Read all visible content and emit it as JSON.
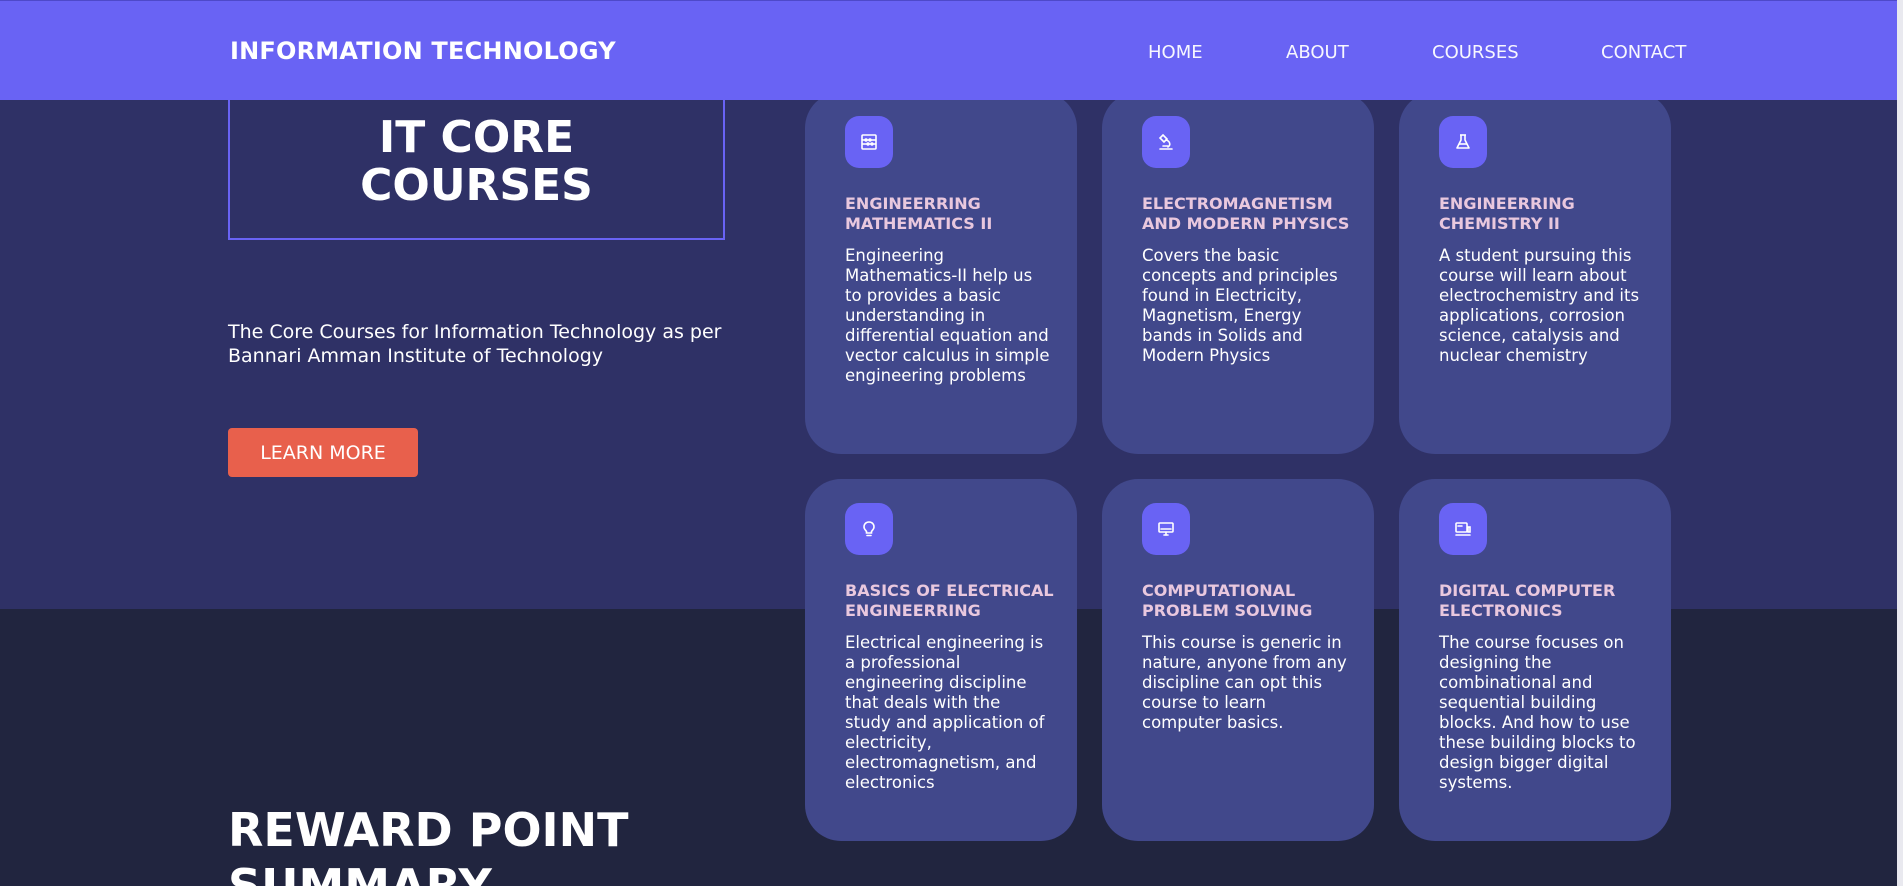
{
  "nav": {
    "brand": "INFORMATION TECHNOLOGY",
    "links": [
      "HOME",
      "ABOUT",
      "COURSES",
      "CONTACT"
    ]
  },
  "hero": {
    "title_line1": "IT CORE",
    "title_line2": "COURSES",
    "description": "The Core Courses for Information Technology as per Bannari Amman Institute of Technology",
    "button": "LEARN MORE"
  },
  "courses": [
    {
      "icon": "abacus-icon",
      "title": "ENGINEERRING MATHEMATICS II",
      "description": "Engineering Mathematics-II help us to provides a basic understanding in differential equation and vector calculus in simple engineering problems"
    },
    {
      "icon": "microscope-icon",
      "title": "ELECTROMAGNETISM AND MODERN PHYSICS",
      "description": "Covers the basic concepts and principles found in Electricity, Magnetism, Energy bands in Solids and Modern Physics"
    },
    {
      "icon": "flask-icon",
      "title": "ENGINEERRING CHEMISTRY II",
      "description": "A student pursuing this course will learn about electrochemistry and its applications, corrosion science, catalysis and nuclear chemistry"
    },
    {
      "icon": "lightbulb-icon",
      "title": "BASICS OF ELECTRICAL ENGINEERRING",
      "description": "Electrical engineering is a professional engineering discipline that deals with the study and application of electricity, electromagnetism, and electronics"
    },
    {
      "icon": "desktop-icon",
      "title": "COMPUTATIONAL PROBLEM SOLVING",
      "description": "This course is generic in nature, anyone from any discipline can opt this course to learn computer basics."
    },
    {
      "icon": "computer-classic-icon",
      "title": "DIGITAL COMPUTER ELECTRONICS",
      "description": "The course focuses on designing the combinational and sequential building blocks. And how to use these building blocks to design bigger digital systems."
    }
  ],
  "reward": {
    "title": "REWARD POINT SUMMARY"
  },
  "colors": {
    "navbar": "#6963f4",
    "hero_bg": "#2f3166",
    "page_bg": "#21253f",
    "card_bg": "#41488b",
    "card_title": "#e9c8de",
    "button": "#e8604c"
  }
}
